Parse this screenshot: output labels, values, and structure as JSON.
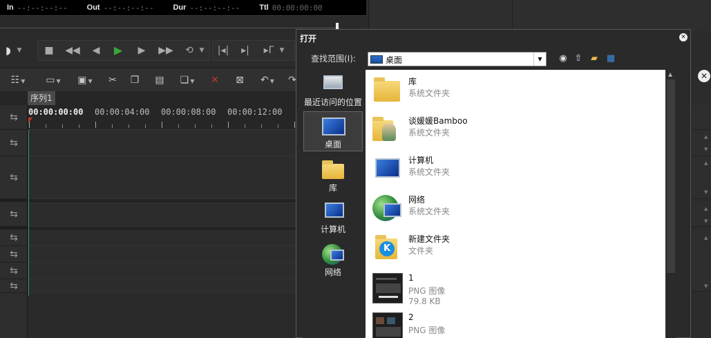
{
  "timecodes": {
    "in_label": "In",
    "in_value": "--:--:--:--",
    "out_label": "Out",
    "out_value": "--:--:--:--",
    "dur_label": "Dur",
    "dur_value": "--:--:--:--",
    "ttl_label": "Ttl",
    "ttl_value": "00:00:00:00"
  },
  "sequence": {
    "tab_label": "序列1"
  },
  "ruler": {
    "labels": [
      "00:00:00:00",
      "00:00:04:00",
      "00:00:08:00",
      "00:00:12:00"
    ]
  },
  "dialog": {
    "title": "打开",
    "look_in_label": "查找范围(I):",
    "look_in_value": "桌面",
    "places": [
      {
        "label": "最近访问的位置",
        "icon": "recent-places-icon",
        "selected": false
      },
      {
        "label": "桌面",
        "icon": "desktop-icon",
        "selected": true
      },
      {
        "label": "库",
        "icon": "libraries-icon",
        "selected": false
      },
      {
        "label": "计算机",
        "icon": "computer-icon",
        "selected": false
      },
      {
        "label": "网络",
        "icon": "network-icon",
        "selected": false
      }
    ],
    "files": [
      {
        "name": "库",
        "type": "系统文件夹",
        "size": "",
        "icon": "libraries-icon"
      },
      {
        "name": "谈媛媛Bamboo",
        "type": "系统文件夹",
        "size": "",
        "icon": "user-folder-icon"
      },
      {
        "name": "计算机",
        "type": "系统文件夹",
        "size": "",
        "icon": "computer-icon"
      },
      {
        "name": "网络",
        "type": "系统文件夹",
        "size": "",
        "icon": "network-icon"
      },
      {
        "name": "新建文件夹",
        "type": "文件夹",
        "size": "",
        "icon": "folder-icon"
      },
      {
        "name": "1",
        "type": "PNG 图像",
        "size": "79.8 KB",
        "icon": "image-thumbnail"
      },
      {
        "name": "2",
        "type": "PNG 图像",
        "size": "",
        "icon": "image-thumbnail"
      }
    ]
  },
  "colors": {
    "play": "#3aa63a",
    "delete": "#c0392b",
    "playhead": "#c0392b",
    "timeline_cursor": "#2fb8a8"
  }
}
